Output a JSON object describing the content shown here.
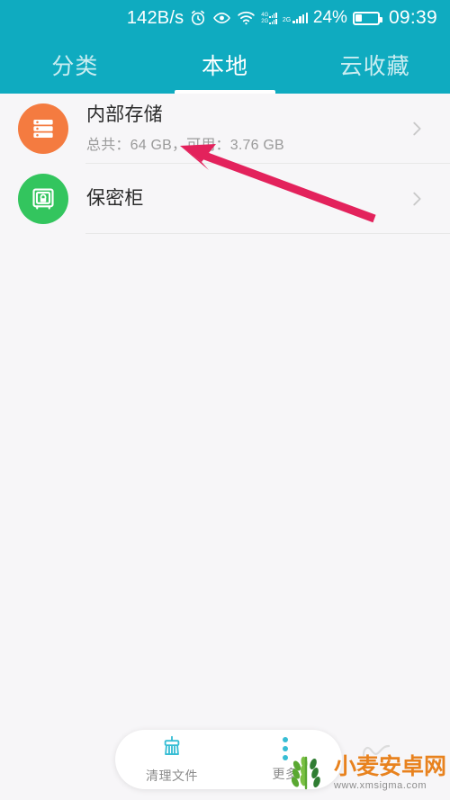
{
  "status_bar": {
    "network_speed": "142B/s",
    "icons": [
      "alarm-icon",
      "eye-icon",
      "wifi-icon",
      "dual-sim-4g-icon",
      "signal-2g-icon"
    ],
    "signal_primary_label_top": "4G",
    "signal_primary_label_bottom": "2G",
    "signal_secondary_label": "2G",
    "battery_percent": "24%",
    "battery_level": 24,
    "clock": "09:39"
  },
  "tabs": [
    {
      "label": "分类",
      "name": "tab-categories",
      "active": false
    },
    {
      "label": "本地",
      "name": "tab-local",
      "active": true
    },
    {
      "label": "云收藏",
      "name": "tab-cloud-favorites",
      "active": false
    }
  ],
  "list": [
    {
      "name": "list-item-internal-storage",
      "icon": "storage-stack-icon",
      "icon_color": "#f47b40",
      "title": "内部存储",
      "subtitle": "总共：64 GB，可用：3.76 GB"
    },
    {
      "name": "list-item-secure-vault",
      "icon": "safe-lock-icon",
      "icon_color": "#33c55e",
      "title": "保密柜",
      "subtitle": ""
    }
  ],
  "bottom_bar": [
    {
      "name": "bottom-action-clean-files",
      "icon": "broom-icon",
      "label": "清理文件"
    },
    {
      "name": "bottom-action-more",
      "icon": "more-vertical-icon",
      "label": "更多"
    }
  ],
  "watermark": {
    "title": "小麦安卓网",
    "url": "www.xmsigma.com"
  },
  "annotation": {
    "type": "arrow",
    "color": "#e3225c",
    "points_to": "内部存储 可用空间"
  },
  "theme": {
    "header": "#0fabc0",
    "background": "#f7f6f8",
    "accent": "#37bdd4",
    "divider": "#e8e8e8"
  }
}
